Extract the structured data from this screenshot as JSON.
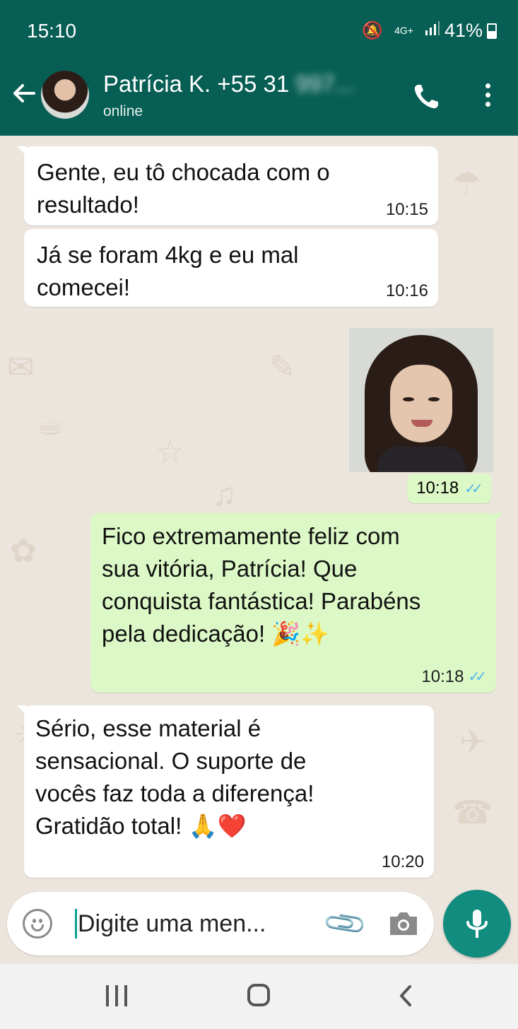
{
  "status_bar": {
    "time": "15:10",
    "network": "4G+",
    "battery": "41%",
    "icons": [
      "mute-icon",
      "signal-icon",
      "battery-icon"
    ]
  },
  "header": {
    "contact_name": "Patrícia K. +55 31",
    "contact_number_blurred": "997...",
    "contact_status": "online",
    "icons": [
      "back-arrow-icon",
      "phone-icon",
      "more-vert-icon"
    ]
  },
  "messages": [
    {
      "direction": "in",
      "text": "Gente, eu tô chocada com o\nresultado!",
      "time": "10:15"
    },
    {
      "direction": "in",
      "text": "Já se foram 4kg e eu mal\ncomecei!",
      "time": "10:16"
    },
    {
      "direction": "out",
      "type": "photo",
      "time": "10:18",
      "read": true
    },
    {
      "direction": "out",
      "text": "Fico extremamente feliz com\nsua vitória, Patrícia! Que\nconquista fantástica! Parabéns\npela dedicação! 🎉✨",
      "time": "10:18",
      "read": true
    },
    {
      "direction": "in",
      "text": "Sério, esse material é\nsensacional. O suporte de\nvocês faz toda a diferença!\nGratidão total! 🙏❤️",
      "time": "10:20"
    }
  ],
  "composer": {
    "placeholder": "Digite uma men...",
    "icons": [
      "emoji-icon",
      "attach-icon",
      "camera-icon",
      "mic-icon"
    ]
  },
  "colors": {
    "header": "#075e54",
    "outgoing_bubble": "#dcf8c6",
    "incoming_bubble": "#ffffff",
    "chat_background": "#ece5dd",
    "read_ticks": "#4fb6ec",
    "fab": "#128c7e"
  }
}
